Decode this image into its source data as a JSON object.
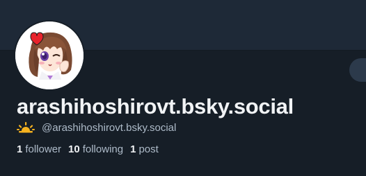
{
  "profile": {
    "display_name": "arashihoshirovt.bsky.social",
    "handle": "@arashihoshirovt.bsky.social",
    "status_icon": "sunrise-icon"
  },
  "stats": {
    "followers_count": "1",
    "followers_label": "follower",
    "following_count": "10",
    "following_label": "following",
    "posts_count": "1",
    "posts_label": "post"
  },
  "colors": {
    "background": "#161e27",
    "banner": "#1e2937",
    "text_primary": "#f1f3f5",
    "text_secondary": "#aebbc9"
  }
}
